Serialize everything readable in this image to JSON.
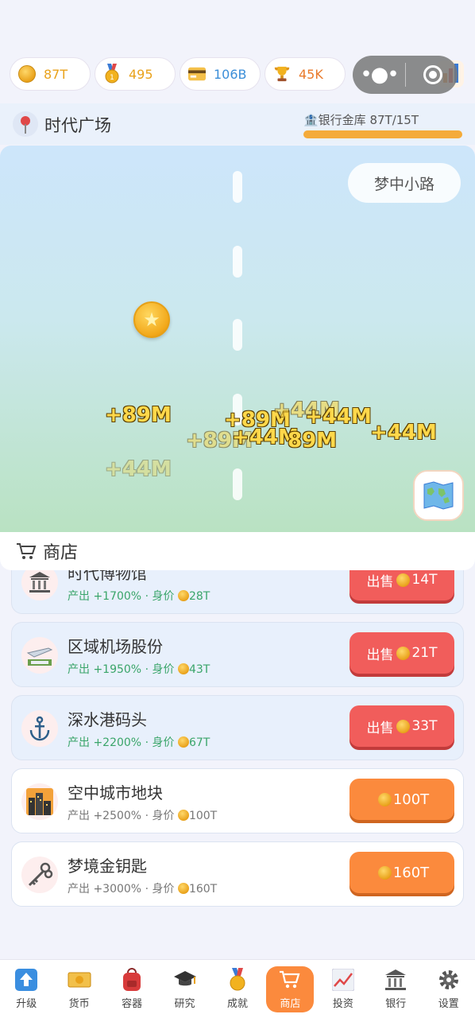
{
  "resources": [
    {
      "icon": "coin-icon",
      "value": "87T",
      "color": "#e9a21b"
    },
    {
      "icon": "medal-icon",
      "value": "495",
      "color": "#e9a21b"
    },
    {
      "icon": "card-icon",
      "value": "106B",
      "color": "#3b8ed8"
    },
    {
      "icon": "trophy-icon",
      "value": "45K",
      "color": "#e97a2b"
    }
  ],
  "location": {
    "title": "时代广场",
    "vault_label": "🏦银行金库  87T/15T",
    "vault_fill": 1.0
  },
  "scene": {
    "road_name": "梦中小路",
    "floats": [
      "+89M",
      "+44M",
      "+89M",
      "+89M",
      "+44M",
      "+44M",
      "+44M",
      "89M",
      "+44M"
    ]
  },
  "shop": {
    "title": "商店",
    "items": [
      {
        "name": "时代博物馆",
        "output": "产出 +1700%",
        "price_label": "· 身价",
        "price": "28T",
        "action": "出售",
        "cost": "14T",
        "owned": true
      },
      {
        "name": "区域机场股份",
        "output": "产出 +1950%",
        "price_label": "· 身价",
        "price": "43T",
        "action": "出售",
        "cost": "21T",
        "owned": true
      },
      {
        "name": "深水港码头",
        "output": "产出 +2200%",
        "price_label": "· 身价",
        "price": "67T",
        "action": "出售",
        "cost": "33T",
        "owned": true
      },
      {
        "name": "空中城市地块",
        "output": "产出 +2500%",
        "price_label": "· 身价",
        "price": "100T",
        "action": "",
        "cost": "100T",
        "owned": false
      },
      {
        "name": "梦境金钥匙",
        "output": "产出 +3000%",
        "price_label": "· 身价",
        "price": "160T",
        "action": "",
        "cost": "160T",
        "owned": false
      }
    ]
  },
  "nav": [
    {
      "label": "升级",
      "icon": "upgrade-icon"
    },
    {
      "label": "货币",
      "icon": "currency-icon"
    },
    {
      "label": "容器",
      "icon": "backpack-icon"
    },
    {
      "label": "研究",
      "icon": "graduation-cap-icon"
    },
    {
      "label": "成就",
      "icon": "medal-icon"
    },
    {
      "label": "商店",
      "icon": "cart-icon",
      "active": true
    },
    {
      "label": "投资",
      "icon": "chart-icon"
    },
    {
      "label": "银行",
      "icon": "bank-icon"
    },
    {
      "label": "设置",
      "icon": "gear-icon"
    }
  ]
}
